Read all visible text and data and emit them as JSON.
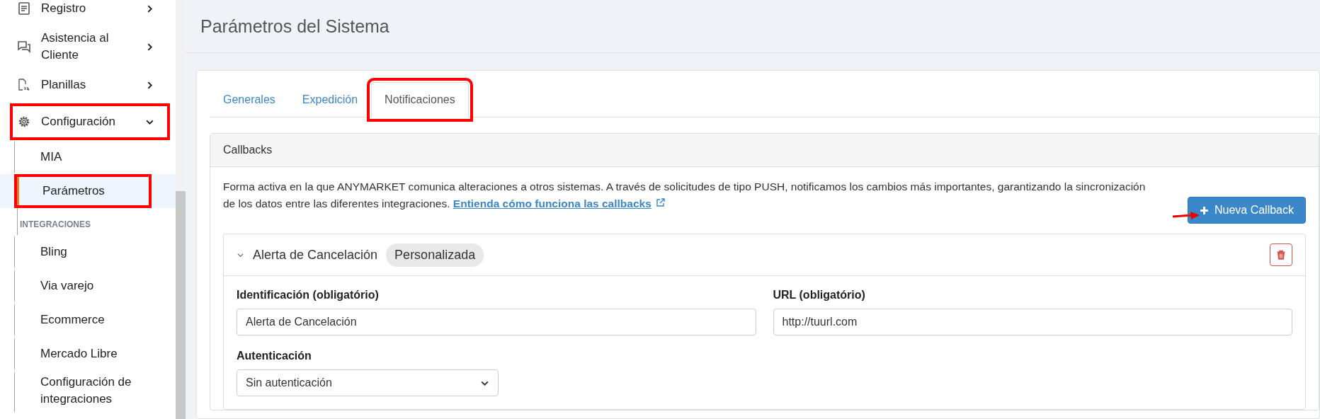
{
  "sidebar": {
    "items": [
      {
        "label": "Registro",
        "kind": "menu",
        "expanded": false,
        "highlighted": false
      },
      {
        "label": "Asistencia al Cliente",
        "kind": "menu",
        "expanded": false,
        "highlighted": false
      },
      {
        "label": "Planillas",
        "kind": "menu",
        "expanded": false,
        "highlighted": false
      },
      {
        "label": "Configuración",
        "kind": "menu",
        "expanded": true,
        "highlighted": true
      },
      {
        "label": "MIA",
        "kind": "sub",
        "selected": false,
        "highlighted": false
      },
      {
        "label": "Parámetros",
        "kind": "sub",
        "selected": true,
        "highlighted": true
      },
      {
        "label": "INTEGRACIONES",
        "kind": "section"
      },
      {
        "label": "Bling",
        "kind": "sub",
        "selected": false,
        "highlighted": false
      },
      {
        "label": "Via varejo",
        "kind": "sub",
        "selected": false,
        "highlighted": false
      },
      {
        "label": "Ecommerce",
        "kind": "sub",
        "selected": false,
        "highlighted": false
      },
      {
        "label": "Mercado Libre",
        "kind": "sub",
        "selected": false,
        "highlighted": false
      },
      {
        "label": "Configuración de integraciones",
        "kind": "sub",
        "selected": false,
        "highlighted": false
      }
    ]
  },
  "page": {
    "title": "Parámetros del Sistema"
  },
  "tabs": [
    {
      "label": "Generales",
      "selected": false,
      "highlighted": false
    },
    {
      "label": "Expedición",
      "selected": false,
      "highlighted": false
    },
    {
      "label": "Notificaciones",
      "selected": true,
      "highlighted": true
    }
  ],
  "panel": {
    "title": "Callbacks",
    "description": "Forma activa en la que ANYMARKET comunica alteraciones a otros sistemas. A través de solicitudes de tipo PUSH, notificamos los cambios más importantes, garantizando la sincronización de los datos entre las diferentes integraciones.",
    "link": "Entienda cómo funciona las callbacks",
    "button": "Nueva Callback",
    "callback": {
      "expanded": true,
      "name": "Alerta de Cancelación",
      "badge": "Personalizada",
      "fields": [
        {
          "label": "Identificación (obligatório)",
          "value": "Alerta de Cancelación",
          "kind": "text"
        },
        {
          "label": "URL (obligatório)",
          "value": "http://tuurl.com",
          "kind": "text"
        },
        {
          "label": "Autenticación",
          "value": "Sin autenticación",
          "kind": "select"
        }
      ]
    }
  }
}
